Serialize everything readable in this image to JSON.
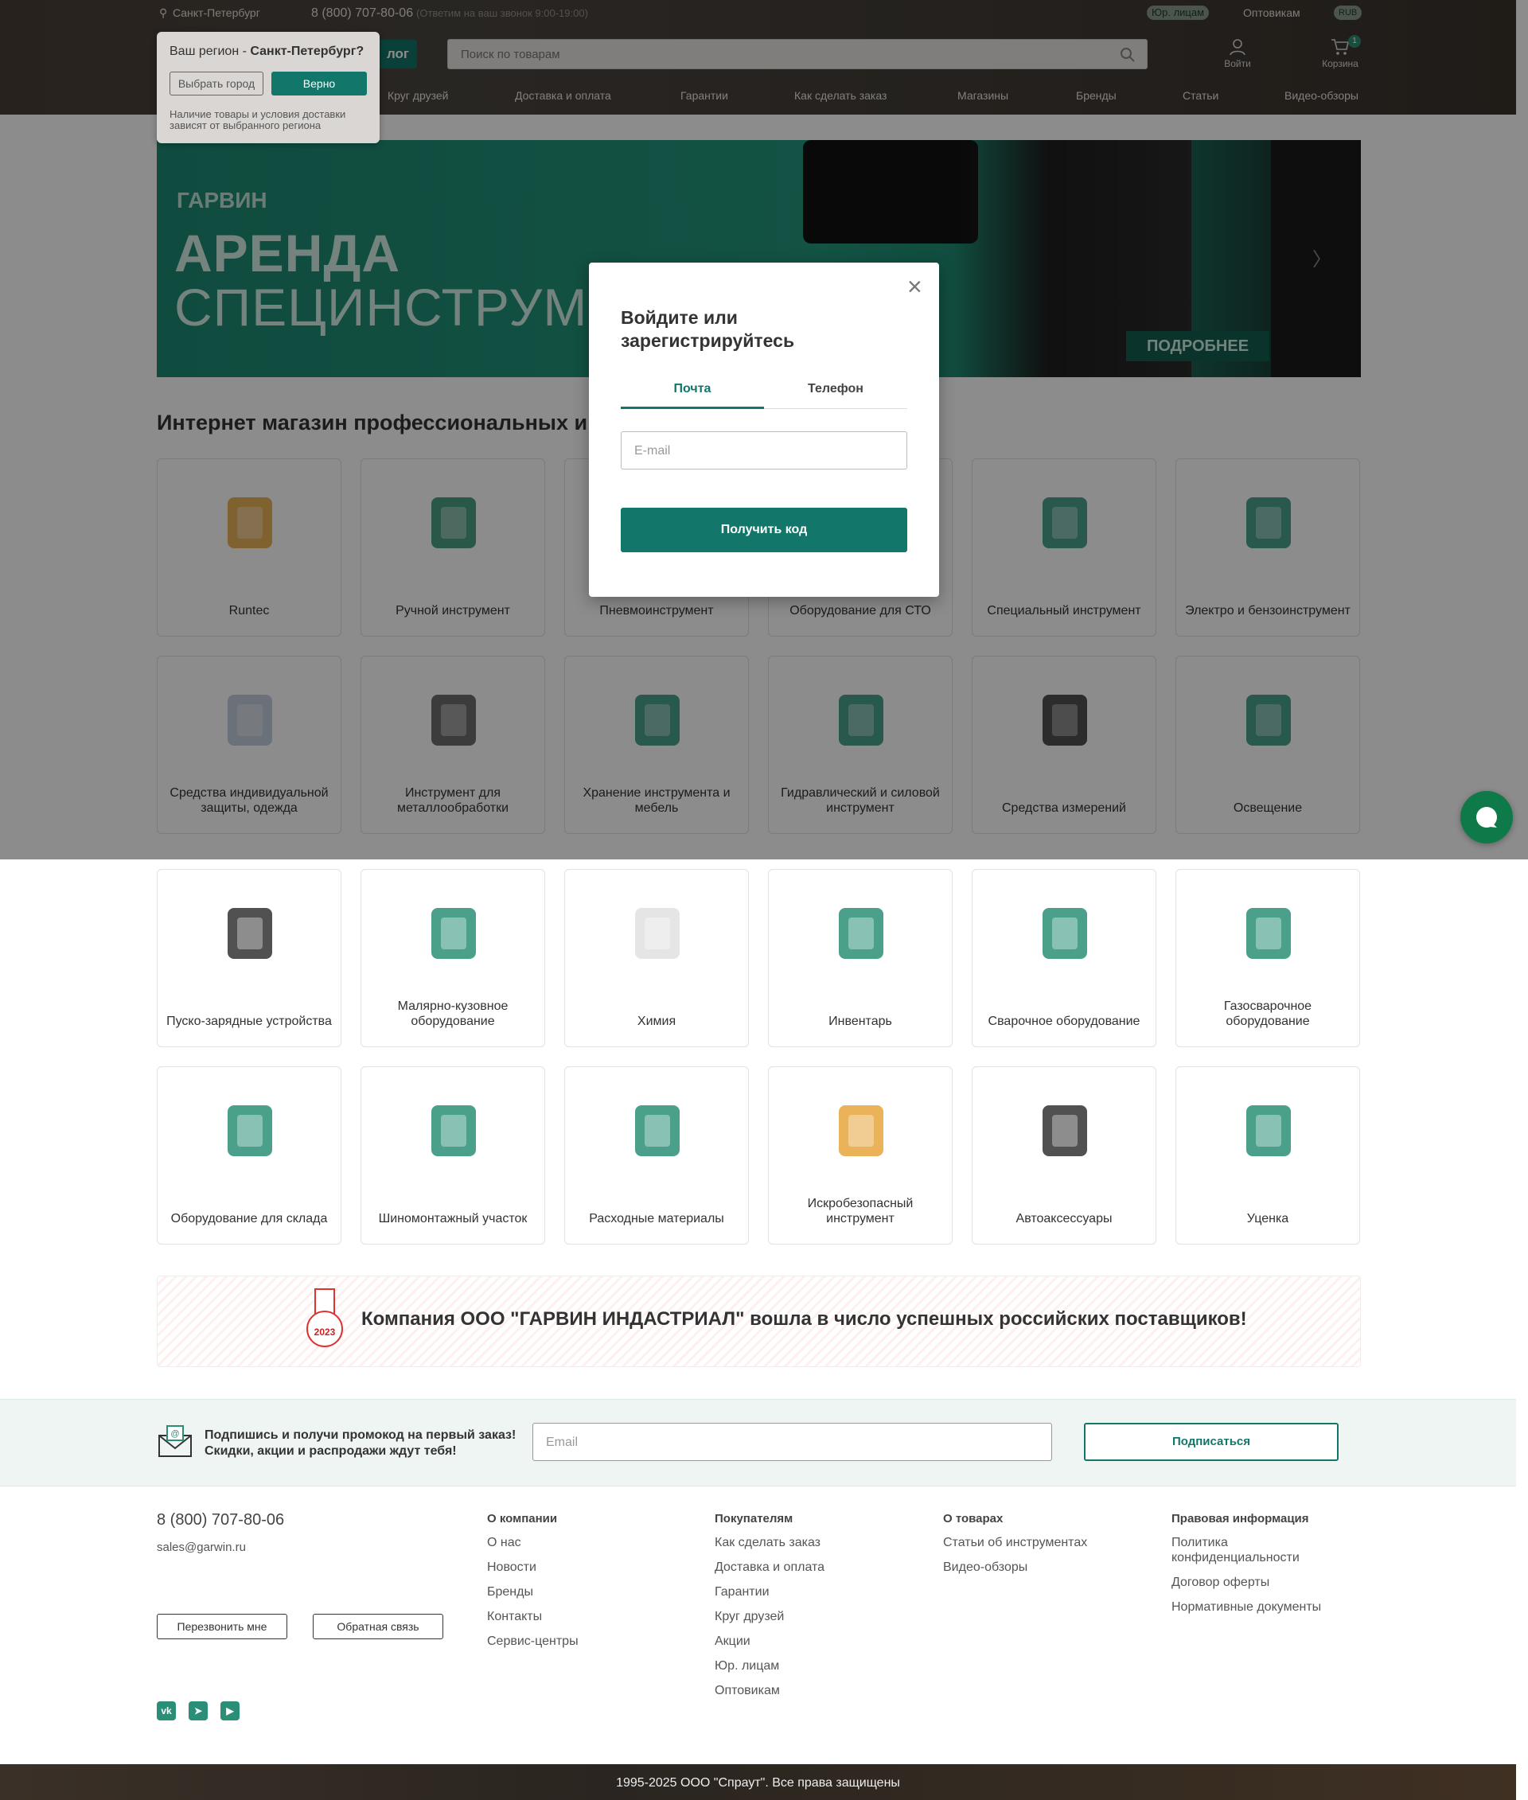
{
  "header": {
    "city": "Санкт-Петербург",
    "phone": "8 (800) 707-80-06",
    "phone_note": "(Ответим на ваш звонок 9:00-19:00)",
    "legal": "Юр. лицам",
    "wholesale": "Оптовикам",
    "currency": "RUB",
    "catalog_label": "лог",
    "search_placeholder": "Поиск по товарам",
    "login_label": "Войти",
    "cart_label": "Корзина",
    "cart_count": "1",
    "nav": [
      "Круг друзей",
      "Доставка и оплата",
      "Гарантии",
      "Как сделать заказ",
      "Магазины",
      "Бренды",
      "Статьи",
      "Видео-обзоры"
    ]
  },
  "region_popup": {
    "question_prefix": "Ваш регион - ",
    "city_bold": "Санкт-Петербург?",
    "choose_btn": "Выбрать город",
    "ok_btn": "Верно",
    "note": "Наличие товары и условия доставки зависят от выбранного региона"
  },
  "banner": {
    "brand": "ГАРВИН",
    "line1": "АРЕНДА",
    "line2": "СПЕЦИНСТРУМЕ",
    "more_btn": "ПОДРОБНЕЕ",
    "next_arrow": "〉"
  },
  "section_title": "Интернет магазин профессиональных ин",
  "categories": [
    "Runtec",
    "Ручной инструмент",
    "Пневмоинструмент",
    "Оборудование для СТО",
    "Специальный инструмент",
    "Электро и бензоинструмент",
    "Средства индивидуальной защиты, одежда",
    "Инструмент для металлообработки",
    "Хранение инструмента и мебель",
    "Гидравлический и силовой инструмент",
    "Средства измерений",
    "Освещение",
    "Пуско-зарядные устройства",
    "Малярно-кузовное оборудование",
    "Химия",
    "Инвентарь",
    "Сварочное оборудование",
    "Газосварочное оборудование",
    "Оборудование для склада",
    "Шиномонтажный участок",
    "Расходные материалы",
    "Искробезопасный инструмент",
    "Автоаксессуары",
    "Уценка"
  ],
  "modal": {
    "title": "Войдите или зарегистрируйтесь",
    "tab_email": "Почта",
    "tab_phone": "Телефон",
    "email_placeholder": "E-mail",
    "submit": "Получить код",
    "close": "×"
  },
  "promo": {
    "text": "Компания ООО \"ГАРВИН ИНДАСТРИАЛ\" вошла в число успешных российских поставщиков!",
    "badge_year": "2023"
  },
  "subscribe": {
    "line1": "Подпишись и получи промокод на первый заказ!",
    "line2": "Скидки, акции и распродажи ждут тебя!",
    "placeholder": "Email",
    "button": "Подписаться"
  },
  "footer": {
    "phone": "8 (800) 707-80-06",
    "email": "sales@garwin.ru",
    "callback_btn": "Перезвонить мне",
    "feedback_btn": "Обратная связь",
    "col1": {
      "title": "О компании",
      "items": [
        "О нас",
        "Новости",
        "Бренды",
        "Контакты",
        "Сервис-центры"
      ]
    },
    "col2": {
      "title": "Покупателям",
      "items": [
        "Как сделать заказ",
        "Доставка и оплата",
        "Гарантии",
        "Круг друзей",
        "Акции",
        "Юр. лицам",
        "Оптовикам"
      ]
    },
    "col3": {
      "title": "О товарах",
      "items": [
        "Статьи об инструментах",
        "Видео-обзоры"
      ]
    },
    "col4": {
      "title": "Правовая информация",
      "items": [
        "Политика конфиденциальности",
        "Договор оферты",
        "Нормативные документы"
      ]
    },
    "social": [
      "vk",
      "tg",
      "yt"
    ],
    "copyright": "1995-2025 ООО \"Спраут\". Все права защищены"
  },
  "colors": {
    "brand_green": "#12766b",
    "accent": "#0e7a4a"
  }
}
